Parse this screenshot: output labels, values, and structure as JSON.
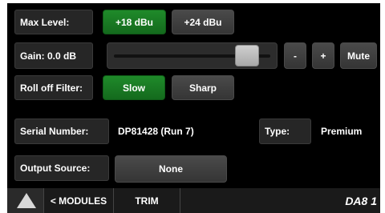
{
  "max_level": {
    "label": "Max Level:",
    "options": [
      "+18 dBu",
      "+24 dBu"
    ],
    "selected": "+18 dBu"
  },
  "gain": {
    "label": "Gain: 0.0 dB",
    "slider_fraction": 0.88,
    "minus_label": "-",
    "plus_label": "+",
    "mute_label": "Mute"
  },
  "roll_off": {
    "label": "Roll off Filter:",
    "options": [
      "Slow",
      "Sharp"
    ],
    "selected": "Slow"
  },
  "serial": {
    "label": "Serial Number:",
    "value": "DP81428 (Run 7)"
  },
  "type": {
    "label": "Type:",
    "value": "Premium"
  },
  "output_source": {
    "label": "Output Source:",
    "value": "None"
  },
  "navbar": {
    "modules_label": "< MODULES",
    "trim_label": "TRIM",
    "device_id": "DA8 1"
  },
  "colors": {
    "active_green": "#1f8a2a",
    "background": "#000000",
    "button_gray": "#404040"
  },
  "icons": {
    "home": "home-triangle-icon"
  }
}
